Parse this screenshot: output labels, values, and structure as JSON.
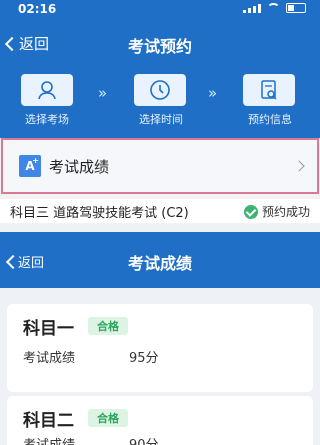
{
  "status_bar": {
    "time": "02:16"
  },
  "screen1": {
    "nav": {
      "back_label": "返回",
      "title": "考试预约"
    },
    "steps": [
      {
        "label": "选择考场",
        "icon": "person-icon"
      },
      {
        "label": "选择时间",
        "icon": "clock-icon"
      },
      {
        "label": "预约信息",
        "icon": "document-search-icon"
      }
    ],
    "grade_entry": {
      "title": "考试成绩"
    },
    "exam_row": {
      "title": "科目三 道路驾驶技能考试 (C2)",
      "status": "预约成功"
    }
  },
  "screen2": {
    "nav": {
      "back_label": "返回",
      "title": "考试成绩"
    },
    "results": [
      {
        "subject": "科目一",
        "badge": "合格",
        "score_label": "考试成绩",
        "score": "95分"
      },
      {
        "subject": "科目二",
        "badge": "合格",
        "score_label": "考试成绩",
        "score": "90分"
      }
    ]
  },
  "colors": {
    "primary": "#1f6fc7",
    "success": "#3cb371",
    "highlight_border": "#d97a95"
  }
}
